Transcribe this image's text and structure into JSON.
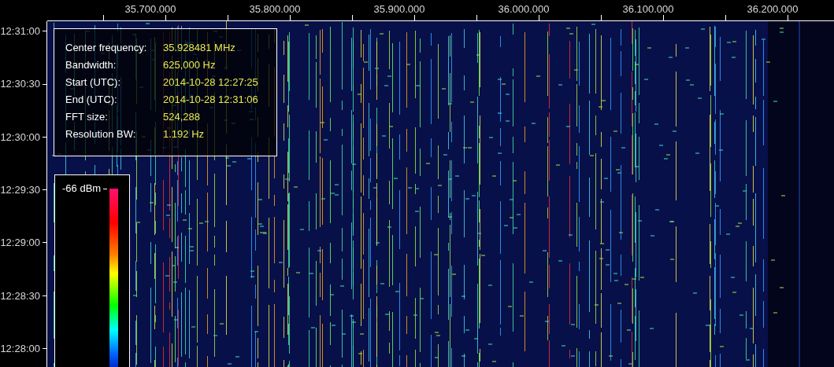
{
  "frequency_axis": {
    "ticks": [
      "35.700.000",
      "35.800.000",
      "35.900.000",
      "36.000.000",
      "36.100.000",
      "36.200.000"
    ]
  },
  "time_axis": {
    "ticks": [
      "12:31:00",
      "12:30:30",
      "12:30:00",
      "12:29:30",
      "12:29:00",
      "12:28:30",
      "12:28:00"
    ]
  },
  "info_panel": {
    "rows": [
      {
        "label": "Center frequency:",
        "value": "35.928481 MHz"
      },
      {
        "label": "Bandwidth:",
        "value": "625,000 Hz"
      },
      {
        "label": "Start (UTC):",
        "value": "2014-10-28 12:27:25"
      },
      {
        "label": "End (UTC):",
        "value": "2014-10-28 12:31:06"
      },
      {
        "label": "FFT size:",
        "value": "524,288"
      },
      {
        "label": "Resolution BW:",
        "value": "1.192 Hz"
      }
    ]
  },
  "legend": {
    "max_label": "-66 dBm"
  }
}
